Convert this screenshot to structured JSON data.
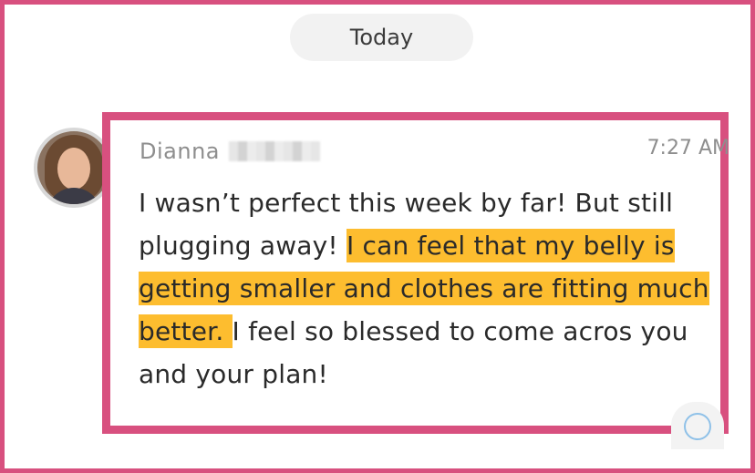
{
  "date_divider": {
    "label": "Today"
  },
  "message": {
    "sender_first_name": "Dianna",
    "time": "7:27 AM",
    "text_plain_1": "I wasn’t perfect this week by far! But still plugging away! ",
    "text_highlight_1": "I can feel that my belly is getting smaller and clothes are fitting much better. ",
    "text_plain_2": " I feel so blessed to come acros you and your plan!"
  },
  "colors": {
    "frame": "#d8507f",
    "highlight": "#fdbd2f",
    "date_pill": "#f2f2f2"
  },
  "icons": {
    "avatar": "avatar-photo",
    "scroll": "scroll-circle-icon"
  }
}
